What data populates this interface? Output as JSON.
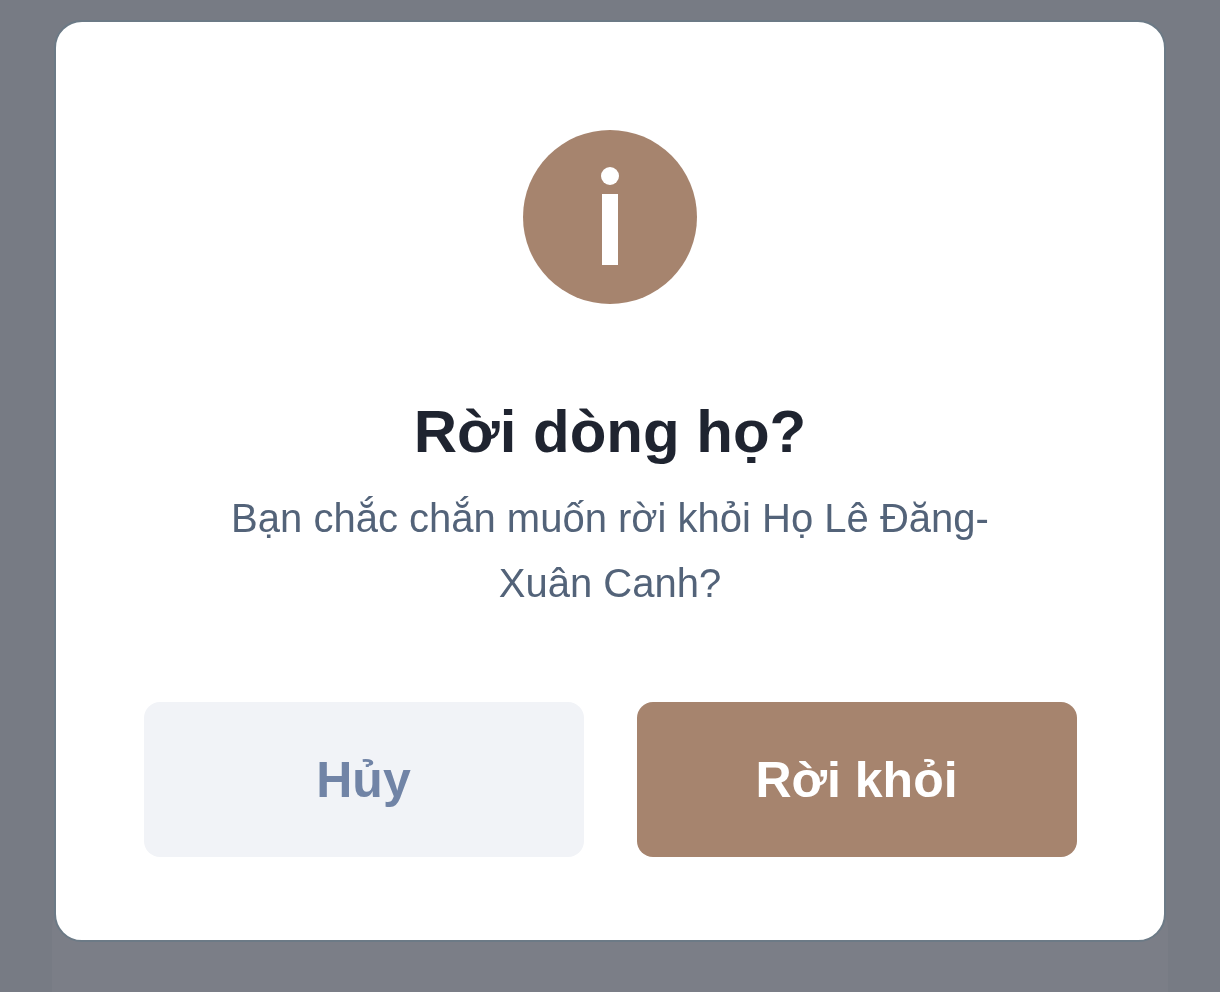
{
  "dialog": {
    "title": "Rời dòng họ?",
    "message": "Bạn chắc chắn muốn rời khỏi Họ Lê Đăng- Xuân Canh?",
    "buttons": [
      {
        "label": "Hủy",
        "kind": "secondary"
      },
      {
        "label": "Rời khỏi",
        "kind": "primary"
      }
    ]
  }
}
